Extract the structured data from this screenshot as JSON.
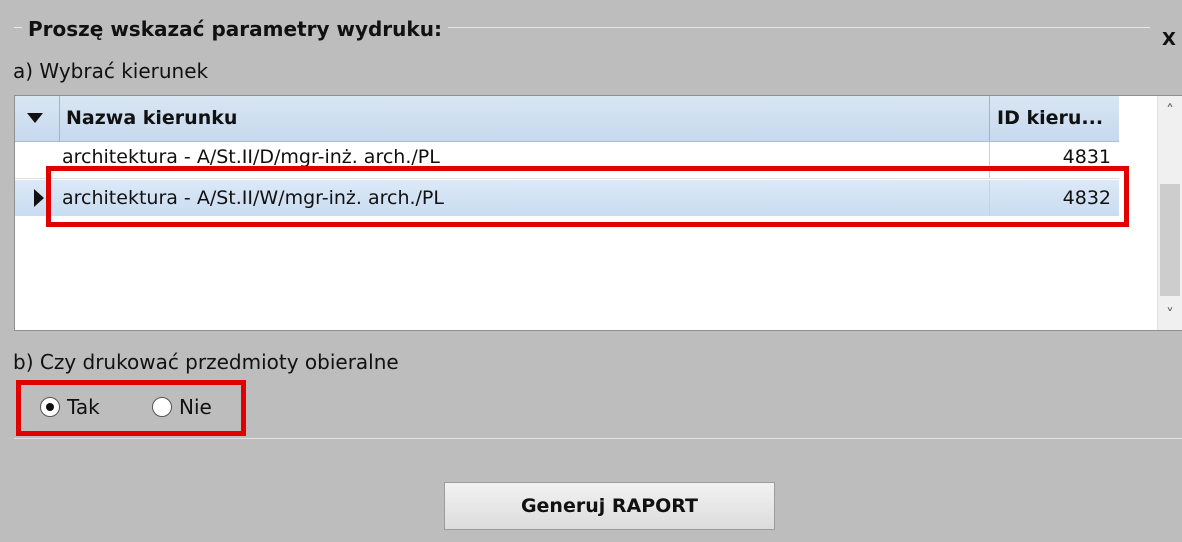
{
  "dialog": {
    "title": "Proszę wskazać parametry wydruku:",
    "close_label": "X"
  },
  "section_a": {
    "label": "a) Wybrać kierunek",
    "grid": {
      "columns": [
        "Nazwa kierunku",
        "ID kieru..."
      ],
      "rows": [
        {
          "name": "architektura - A/St.II/D/mgr-inż. arch./PL",
          "id": "4831"
        },
        {
          "name": "architektura  - A/St.II/W/mgr-inż. arch./PL",
          "id": "4832"
        }
      ],
      "selected_row": 1
    }
  },
  "section_b": {
    "label": "b) Czy drukować przedmioty obieralne",
    "options": [
      {
        "label": "Tak",
        "selected": true
      },
      {
        "label": "Nie",
        "selected": false
      }
    ]
  },
  "actions": {
    "generate_label": "Generuj RAPORT"
  },
  "colors": {
    "highlight": "#e00000",
    "background": "#bdbdbd",
    "header": "#c6d9ee",
    "selected_row": "#c9dcf1"
  },
  "icons": {
    "header_sort": "triangle-down",
    "row_pointer": "triangle-right",
    "scroll_up": "chevron-up",
    "scroll_down": "chevron-down"
  }
}
